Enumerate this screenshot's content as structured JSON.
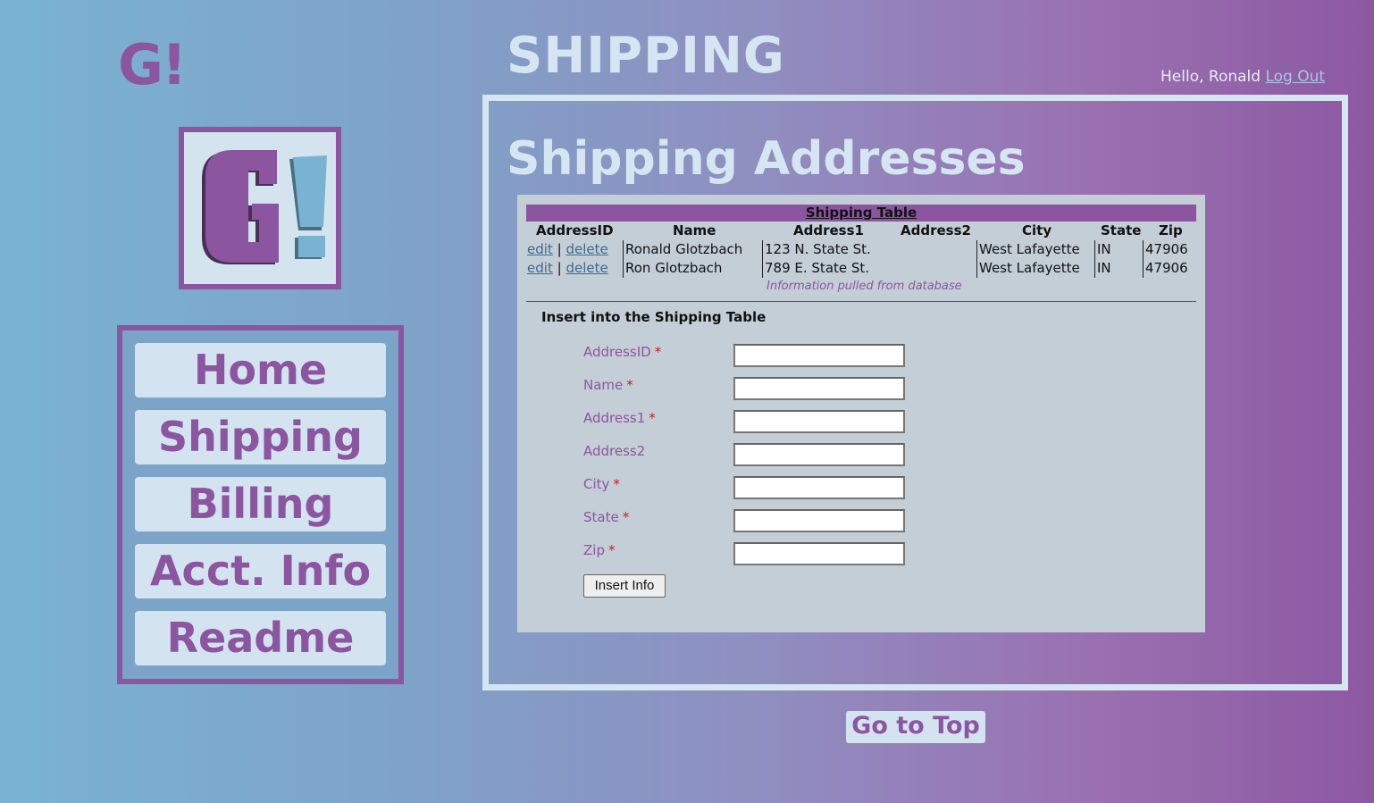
{
  "brand": {
    "logo_text": "G!",
    "logo_icon": "g-exclamation-logo-icon"
  },
  "nav": {
    "items": [
      {
        "label": "Home"
      },
      {
        "label": "Shipping"
      },
      {
        "label": "Billing"
      },
      {
        "label": "Acct. Info"
      },
      {
        "label": "Readme"
      }
    ]
  },
  "header": {
    "title": "SHIPPING",
    "greeting": "Hello, Ronald",
    "logout_label": "Log Out"
  },
  "main": {
    "section_title": "Shipping Addresses",
    "table": {
      "caption": "Shipping Table",
      "columns": [
        "AddressID",
        "Name",
        "Address1",
        "Address2",
        "City",
        "State",
        "Zip"
      ],
      "edit_label": "edit",
      "separator": "|",
      "delete_label": "delete",
      "rows": [
        {
          "name": "Ronald Glotzbach",
          "address1": "123 N. State St.",
          "address2": "",
          "city": "West Lafayette",
          "state": "IN",
          "zip": "47906"
        },
        {
          "name": "Ron Glotzbach",
          "address1": "789 E. State St.",
          "address2": "",
          "city": "West Lafayette",
          "state": "IN",
          "zip": "47906"
        }
      ],
      "footnote": "Information pulled from database"
    },
    "form": {
      "title": "Insert into the Shipping Table",
      "required_mark": "*",
      "fields": [
        {
          "label": "AddressID",
          "required": true,
          "value": ""
        },
        {
          "label": "Name",
          "required": true,
          "value": ""
        },
        {
          "label": "Address1",
          "required": true,
          "value": ""
        },
        {
          "label": "Address2",
          "required": false,
          "value": ""
        },
        {
          "label": "City",
          "required": true,
          "value": ""
        },
        {
          "label": "State",
          "required": true,
          "value": ""
        },
        {
          "label": "Zip",
          "required": true,
          "value": ""
        }
      ],
      "submit_label": "Insert Info"
    }
  },
  "footer": {
    "go_top_label": "Go to Top"
  },
  "colors": {
    "accent": "#8c55a0",
    "light": "#d3e4f0",
    "card": "#c4ced6",
    "required": "#d01a1a"
  }
}
